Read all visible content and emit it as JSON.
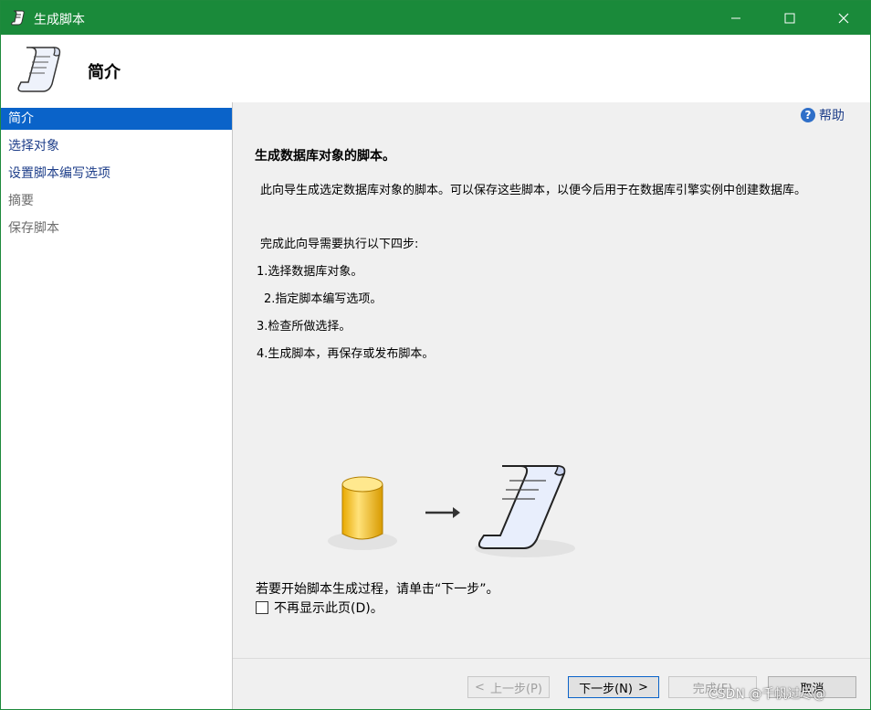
{
  "window": {
    "title": "生成脚本"
  },
  "header": {
    "title": "简介"
  },
  "nav": {
    "items": [
      {
        "label": "简介",
        "state": "active"
      },
      {
        "label": "选择对象",
        "state": "link"
      },
      {
        "label": "设置脚本编写选项",
        "state": "link"
      },
      {
        "label": "摘要",
        "state": "disabled"
      },
      {
        "label": "保存脚本",
        "state": "disabled"
      }
    ]
  },
  "content": {
    "help_label": "帮助",
    "heading": "生成数据库对象的脚本。",
    "description": "此向导生成选定数据库对象的脚本。可以保存这些脚本，以便今后用于在数据库引擎实例中创建数据库。",
    "steps_intro": "完成此向导需要执行以下四步:",
    "steps": [
      "1.选择数据库对象。",
      "2.指定脚本编写选项。",
      "3.检查所做选择。",
      "4.生成脚本，再保存或发布脚本。"
    ],
    "footer_note": "若要开始脚本生成过程，请单击“下一步”。",
    "checkbox_label": "不再显示此页(D)。",
    "checkbox_checked": false
  },
  "buttons": {
    "prev": "上一步(P)",
    "next": "下一步(N)",
    "finish": "完成(F)",
    "cancel": "取消"
  },
  "watermark": "CSDN @千帆过尽@",
  "colors": {
    "titlebar": "#1a8a3a",
    "selection": "#0a63c9",
    "link": "#1f3f8a"
  }
}
